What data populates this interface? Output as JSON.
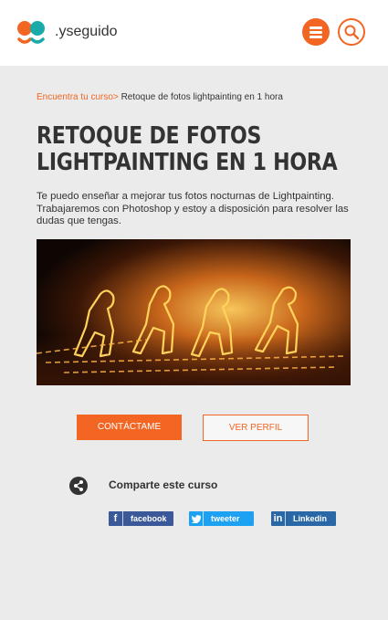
{
  "header": {
    "brand": ".yseguido",
    "menu_icon": "hamburger-menu-icon",
    "search_icon": "search-icon",
    "accent_color": "#f26522"
  },
  "breadcrumb": {
    "link": "Encuentra tu curso>",
    "current": "Retoque de fotos lightpainting en 1 hora"
  },
  "course": {
    "title_line1": "RETOQUE DE FOTOS",
    "title_line2": "LIGHTPAINTING EN 1 HORA",
    "description": "Te puedo enseñar a mejorar tus fotos nocturnas de Lightpainting. Trabajaremos con Photoshop y estoy a disposición para resolver las dudas que tengas."
  },
  "actions": {
    "contact_label": "CONTÁCTAME",
    "profile_label": "VER PERFIL"
  },
  "share": {
    "title": "Comparte este curso",
    "facebook": "facebook",
    "twitter": "tweeter",
    "linkedin": "Linkedin"
  }
}
